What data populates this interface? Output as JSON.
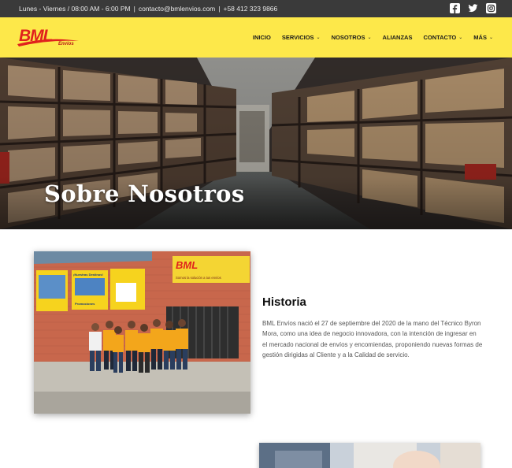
{
  "topbar": {
    "hours": "Lunes - Viernes / 08:00 AM - 6:00 PM",
    "email": "contacto@bmlenvios.com",
    "phone": "+58 412 323 9866",
    "separator": "|",
    "social": [
      "facebook-square-icon",
      "twitter-icon",
      "instagram-icon"
    ]
  },
  "header": {
    "logo_text": "BML",
    "logo_subtext": "Envios",
    "nav": [
      {
        "label": "INICIO",
        "dropdown": false
      },
      {
        "label": "SERVICIOS",
        "dropdown": true
      },
      {
        "label": "NOSOTROS",
        "dropdown": true
      },
      {
        "label": "ALIANZAS",
        "dropdown": false
      },
      {
        "label": "CONTACTO",
        "dropdown": true
      },
      {
        "label": "MÁS",
        "dropdown": true
      }
    ]
  },
  "hero": {
    "title": "Sobre Nosotros"
  },
  "historia": {
    "title": "Historia",
    "text": "BML Envíos nació el 27 de septiembre del 2020 de la mano del Técnico Byron Mora, como una idea de negocio innovadora, con la intención de ingresar en el mercado nacional de envíos y encomiendas, proponiendo nuevas formas de gestión dirigidas al Cliente y a la Calidad de servicio."
  },
  "photo_sign": {
    "brand": "BML",
    "slogan": "Somos la solución a tus envíos",
    "banner1": "¡Nuestras Destinos!",
    "banner2": "Promociones"
  },
  "colors": {
    "topbar_bg": "#3a3a3a",
    "header_bg": "#fde84a",
    "brand_red": "#e0211d",
    "text_muted": "#555555"
  }
}
